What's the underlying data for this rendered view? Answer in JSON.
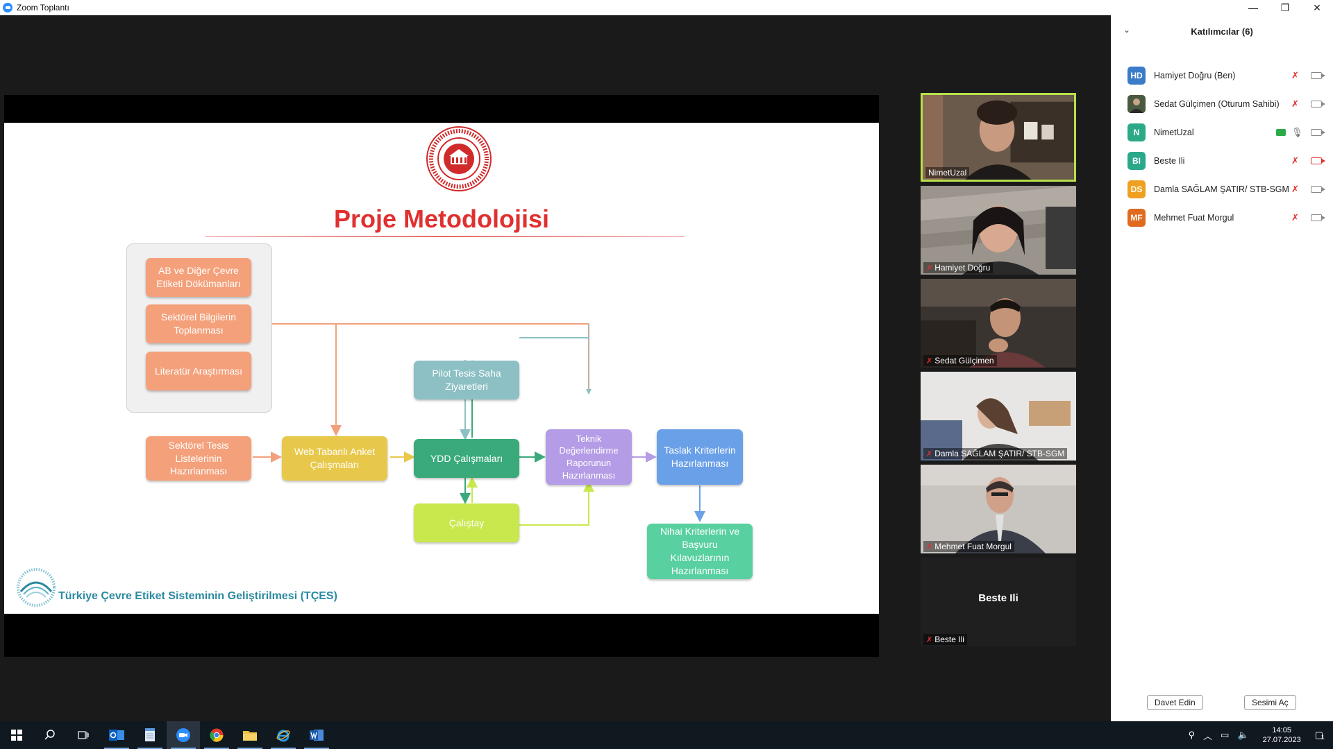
{
  "window": {
    "title": "Zoom Toplantı",
    "min": "—",
    "restore": "❐",
    "close": "✕"
  },
  "slide": {
    "title": "Proje Metodolojisi",
    "footer": "Türkiye Çevre Etiket Sisteminin Geliştirilmesi (TÇES)",
    "boxes": {
      "ab_docs": "AB ve Diğer Çevre Etiketi Dökümanları",
      "sector_info": "Sektörel Bilgilerin Toplanması",
      "literature": "Literatür Araştırması",
      "facility_lists": "Sektörel Tesis Listelerinin Hazırlanması",
      "web_survey": "Web Tabanlı Anket Çalışmaları",
      "pilot_visits": "Pilot Tesis Saha Ziyaretleri",
      "ydd": "YDD Çalışmaları",
      "workshop": "Çalıştay",
      "tech_report": "Teknik Değerlendirme Raporunun Hazırlanması",
      "draft_criteria": "Taslak Kriterlerin Hazırlanması",
      "final_criteria": "Nihai Kriterlerin ve Başvuru Kılavuzlarının Hazırlanması"
    }
  },
  "tiles": [
    {
      "name": "NimetUzal",
      "active": true,
      "muted": false
    },
    {
      "name": "Hamiyet Doğru",
      "active": false,
      "muted": true
    },
    {
      "name": "Sedat Gülçimen",
      "active": false,
      "muted": true
    },
    {
      "name": "Damla SAĞLAM ŞATIR/ STB-SGM",
      "active": false,
      "muted": true
    },
    {
      "name": "Mehmet Fuat Morgul",
      "active": false,
      "muted": true
    },
    {
      "name": "Beste Ili",
      "active": false,
      "muted": true,
      "video_off": true
    }
  ],
  "panel": {
    "title": "Katılımcılar (6)",
    "participants": [
      {
        "initials": "HD",
        "name": "Hamiyet Doğru (Ben)",
        "color": "#3a7cc8",
        "muted": true,
        "video_off": false
      },
      {
        "initials": "",
        "name": "Sedat Gülçimen (Oturum Sahibi)",
        "color": "#5a6a4a",
        "muted": true,
        "video_off": false
      },
      {
        "initials": "N",
        "name": "NimetUzal",
        "color": "#2caa88",
        "muted": false,
        "video_off": false,
        "sharing": true
      },
      {
        "initials": "BI",
        "name": "Beste Ili",
        "color": "#2aa88a",
        "muted": true,
        "video_off": true
      },
      {
        "initials": "DS",
        "name": "Damla SAĞLAM ŞATIR/ STB-SGM",
        "color": "#f0a020",
        "muted": true,
        "video_off": false
      },
      {
        "initials": "MF",
        "name": "Mehmet Fuat Morgul",
        "color": "#e06a20",
        "muted": true,
        "video_off": false
      }
    ],
    "invite": "Davet Edin",
    "unmute": "Sesimi Aç"
  },
  "taskbar": {
    "time": "14:05",
    "date": "27.07.2023",
    "notifications": "1",
    "apps": [
      "windows-start",
      "search",
      "task-view",
      "outlook",
      "notepad",
      "zoom",
      "chrome",
      "file-explorer",
      "internet-explorer",
      "word"
    ]
  },
  "colors": {
    "zoom_blue": "#2d8cff",
    "active_speaker": "#b8e04a",
    "slide_title": "#e03030"
  }
}
